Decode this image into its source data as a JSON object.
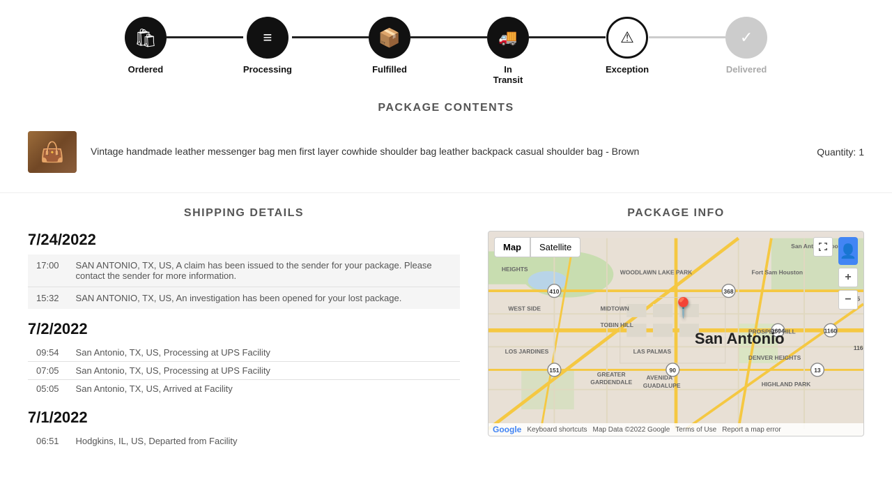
{
  "steps": [
    {
      "id": "ordered",
      "label": "Ordered",
      "icon": "🛍",
      "state": "active",
      "multiline": false
    },
    {
      "id": "processing",
      "label": "Processing",
      "icon": "≡",
      "state": "active",
      "multiline": false
    },
    {
      "id": "fulfilled",
      "label": "Fulfilled",
      "icon": "📦",
      "state": "active",
      "multiline": false
    },
    {
      "id": "in-transit",
      "label": "In Transit",
      "icon": "🚚",
      "state": "active",
      "multiline": true
    },
    {
      "id": "exception",
      "label": "Exception",
      "icon": "⚠",
      "state": "warning",
      "multiline": false
    },
    {
      "id": "delivered",
      "label": "Delivered",
      "icon": "✓",
      "state": "inactive",
      "multiline": false
    }
  ],
  "connectors": [
    "active",
    "active",
    "active",
    "active",
    "dimmed"
  ],
  "package_contents": {
    "title": "PACKAGE CONTENTS",
    "items": [
      {
        "description": "Vintage handmade leather messenger bag men first layer cowhide shoulder bag leather backpack casual shoulder bag - Brown",
        "quantity_label": "Quantity:",
        "quantity": "1"
      }
    ]
  },
  "shipping_details": {
    "title": "SHIPPING DETAILS",
    "date_groups": [
      {
        "date": "7/24/2022",
        "events": [
          {
            "time": "17:00",
            "desc": "SAN ANTONIO, TX, US, A claim has been issued to the sender for your package. Please contact the sender for more information.",
            "highlight": true
          },
          {
            "time": "15:32",
            "desc": "SAN ANTONIO, TX, US, An investigation has been opened for your lost package.",
            "highlight": true
          }
        ]
      },
      {
        "date": "7/2/2022",
        "events": [
          {
            "time": "09:54",
            "desc": "San Antonio, TX, US, Processing at UPS Facility",
            "highlight": false
          },
          {
            "time": "07:05",
            "desc": "San Antonio, TX, US, Processing at UPS Facility",
            "highlight": false
          },
          {
            "time": "05:05",
            "desc": "San Antonio, TX, US, Arrived at Facility",
            "highlight": false
          }
        ]
      },
      {
        "date": "7/1/2022",
        "events": [
          {
            "time": "06:51",
            "desc": "Hodgkins, IL, US, Departed from Facility",
            "highlight": false
          }
        ]
      }
    ]
  },
  "package_info": {
    "title": "PACKAGE INFO",
    "map": {
      "type_buttons": [
        "Map",
        "Satellite"
      ],
      "active_type": "Map",
      "city": "San Antonio",
      "zoom_in": "+",
      "zoom_out": "−",
      "footer": {
        "google": "Google",
        "keyboard": "Keyboard shortcuts",
        "data": "Map Data ©2022 Google",
        "terms": "Terms of Use",
        "report": "Report a map error"
      }
    }
  }
}
